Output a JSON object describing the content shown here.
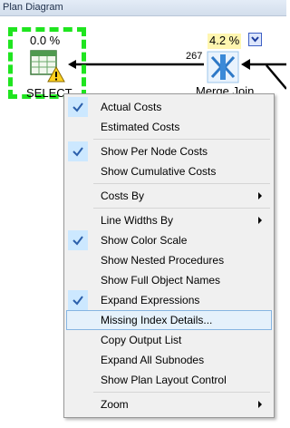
{
  "panel": {
    "title": "Plan Diagram"
  },
  "nodes": {
    "select": {
      "percent": "0.0 %",
      "label": "SELECT"
    },
    "merge_join": {
      "percent": "4.2 %",
      "label": "Merge Join",
      "rows": "267"
    }
  },
  "colors": {
    "selected_node_border": "#1fe51f",
    "highlight": "#e5f1fb",
    "checkmark": "#2b5fab"
  },
  "icons": [
    "table-icon",
    "warning-icon",
    "merge-join-icon",
    "chevron-down-icon",
    "checkmark-icon",
    "submenu-arrow-icon"
  ],
  "menu": {
    "actual_costs": "Actual Costs",
    "estimated_costs": "Estimated Costs",
    "show_per_node_costs": "Show Per Node Costs",
    "show_cumulative_costs": "Show Cumulative Costs",
    "costs_by": "Costs By",
    "line_widths_by": "Line Widths By",
    "show_color_scale": "Show Color Scale",
    "show_nested_procedures": "Show Nested Procedures",
    "show_full_object_names": "Show Full Object Names",
    "expand_expressions": "Expand Expressions",
    "missing_index_details": "Missing Index Details...",
    "copy_output_list": "Copy Output List",
    "expand_all_subnodes": "Expand All Subnodes",
    "show_plan_layout_control": "Show Plan Layout Control",
    "zoom": "Zoom"
  },
  "checked": {
    "actual_costs": true,
    "show_per_node_costs": true,
    "show_color_scale": true,
    "expand_expressions": true
  }
}
